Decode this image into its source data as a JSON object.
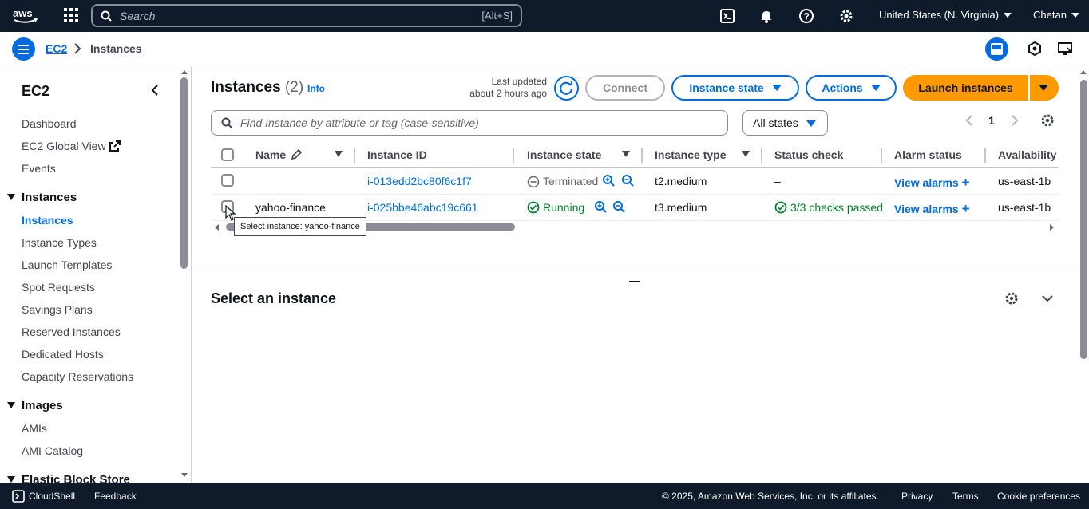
{
  "topnav": {
    "search_placeholder": "Search",
    "search_shortcut": "[Alt+S]",
    "region": "United States (N. Virginia)",
    "user": "Chetan"
  },
  "breadcrumb": {
    "root": "EC2",
    "current": "Instances"
  },
  "sidebar": {
    "title": "EC2",
    "top_links": [
      "Dashboard",
      "EC2 Global View",
      "Events"
    ],
    "sections": [
      {
        "title": "Instances",
        "items": [
          "Instances",
          "Instance Types",
          "Launch Templates",
          "Spot Requests",
          "Savings Plans",
          "Reserved Instances",
          "Dedicated Hosts",
          "Capacity Reservations"
        ]
      },
      {
        "title": "Images",
        "items": [
          "AMIs",
          "AMI Catalog"
        ]
      },
      {
        "title": "Elastic Block Store",
        "items": []
      }
    ],
    "active_item": "Instances"
  },
  "main": {
    "title": "Instances",
    "count": "(2)",
    "info": "Info",
    "last_updated_label": "Last updated",
    "last_updated_value": "about 2 hours ago",
    "connect": "Connect",
    "instance_state": "Instance state",
    "actions": "Actions",
    "launch": "Launch instances",
    "filter_placeholder": "Find Instance by attribute or tag (case-sensitive)",
    "state_filter": "All states",
    "page": "1"
  },
  "table": {
    "columns": [
      "Name",
      "Instance ID",
      "Instance state",
      "Instance type",
      "Status check",
      "Alarm status",
      "Availability"
    ],
    "rows": [
      {
        "name": "",
        "id": "i-013edd2bc80f6c1f7",
        "state": "Terminated",
        "type": "t2.medium",
        "status": "–",
        "alarm": "View alarms",
        "az": "us-east-1b"
      },
      {
        "name": "yahoo-finance",
        "id": "i-025bbe46abc19c661",
        "state": "Running",
        "type": "t3.medium",
        "status": "3/3 checks passed",
        "alarm": "View alarms",
        "az": "us-east-1b"
      }
    ],
    "tooltip": "Select instance: yahoo-finance"
  },
  "detail": {
    "title": "Select an instance"
  },
  "footer": {
    "cloudshell": "CloudShell",
    "feedback": "Feedback",
    "copyright": "© 2025, Amazon Web Services, Inc. or its affiliates.",
    "privacy": "Privacy",
    "terms": "Terms",
    "cookies": "Cookie preferences"
  },
  "colors": {
    "nav_bg": "#0f1b2a",
    "link": "#006ce0",
    "primary": "#ff9900",
    "success": "#00802f"
  }
}
